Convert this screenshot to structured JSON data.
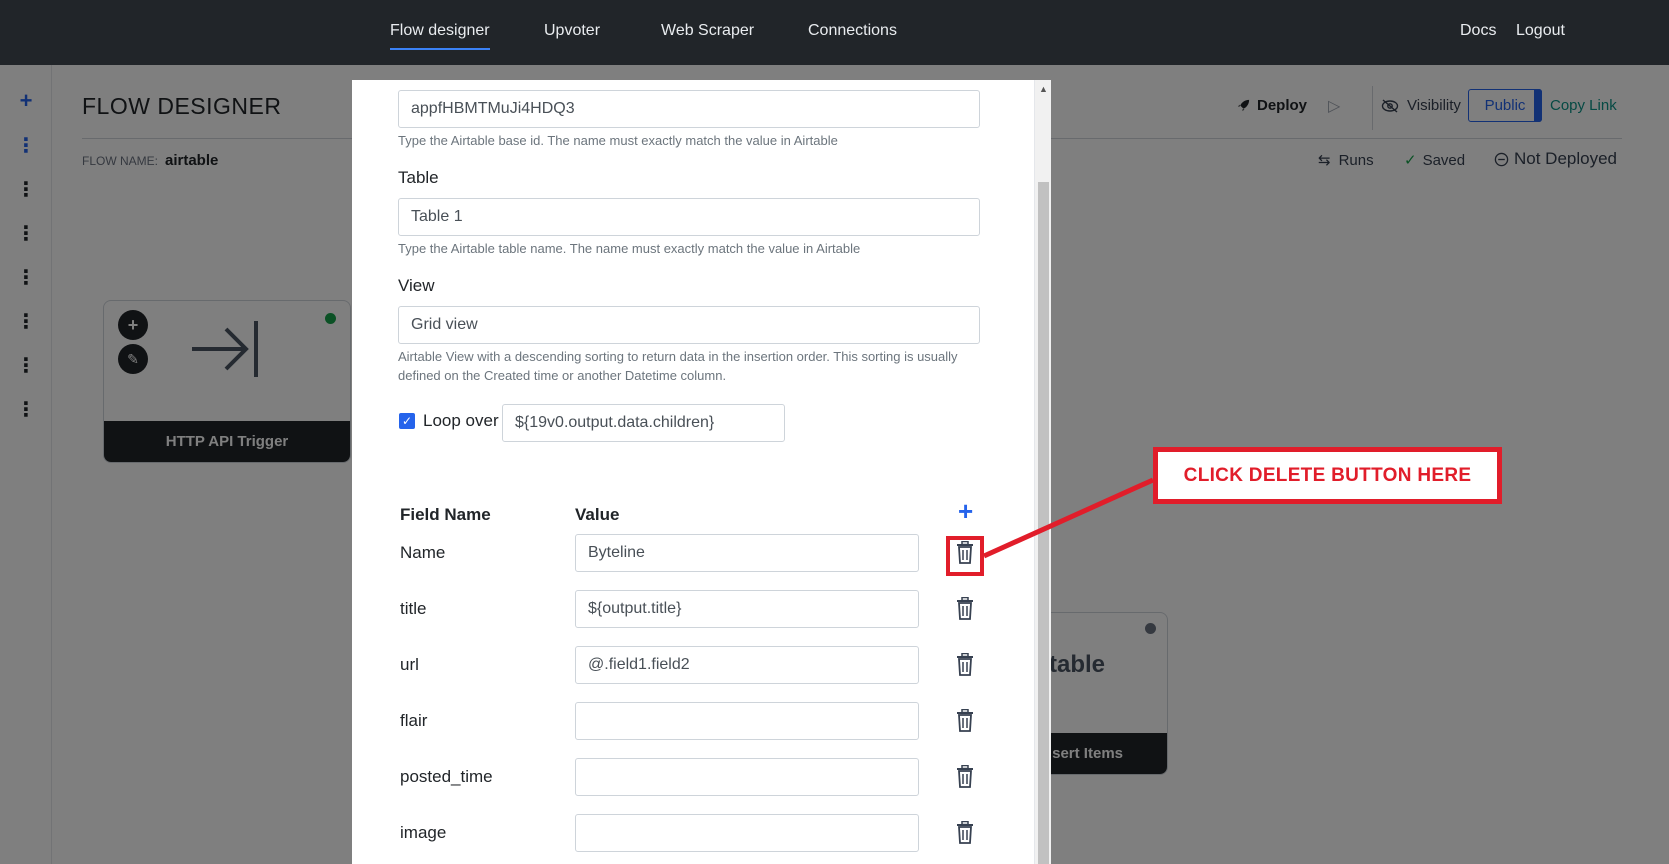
{
  "topnav": {
    "items": [
      "Flow designer",
      "Upvoter",
      "Web Scraper",
      "Connections"
    ],
    "docs": "Docs",
    "logout": "Logout"
  },
  "page": {
    "title": "FLOW DESIGNER",
    "flow_name_label": "FLOW NAME:",
    "flow_name": "airtable"
  },
  "toolbar": {
    "deploy": "Deploy",
    "visibility": "Visibility",
    "public": "Public",
    "copy_link": "Copy Link",
    "runs": "Runs",
    "saved": "Saved",
    "not_deployed": "Not Deployed"
  },
  "nodes": {
    "trigger_label": "HTTP API Trigger",
    "trigger_status_color": "#16a34a",
    "airtable_logo": "rtable",
    "airtable_label": "sert Items",
    "airtable_status_color": "#6b7280"
  },
  "modal": {
    "base_id_value": "appfHBMTMuJi4HDQ3",
    "base_id_help": "Type the Airtable base id. The name must exactly match the value in Airtable",
    "table_label": "Table",
    "table_value": "Table 1",
    "table_help": "Type the Airtable table name. The name must exactly match the value in Airtable",
    "view_label": "View",
    "view_value": "Grid view",
    "view_help_1": "Airtable View with a descending sorting to return data in the insertion order. This sorting is usually",
    "view_help_2": "defined on the Created time or another Datetime column.",
    "loop_label": "Loop over",
    "loop_checked": true,
    "loop_value": "${19v0.output.data.children}",
    "col_field_name": "Field Name",
    "col_value": "Value",
    "fields": [
      {
        "name": "Name",
        "value": "Byteline"
      },
      {
        "name": "title",
        "value": "${output.title}"
      },
      {
        "name": "url",
        "value": "@.field1.field2"
      },
      {
        "name": "flair",
        "value": ""
      },
      {
        "name": "posted_time",
        "value": ""
      },
      {
        "name": "image",
        "value": ""
      }
    ]
  },
  "annotation": {
    "text": "CLICK DELETE BUTTON HERE",
    "color": "#e11d2a"
  },
  "colors": {
    "nav_bg": "#212529",
    "accent": "#2563eb"
  }
}
